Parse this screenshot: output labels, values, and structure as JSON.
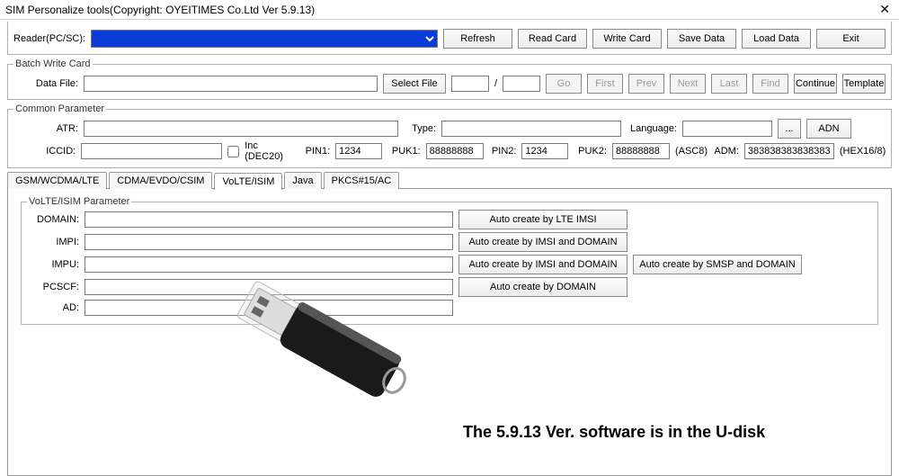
{
  "window": {
    "title": "SIM Personalize tools(Copyright: OYEITIMES Co.Ltd  Ver 5.9.13)"
  },
  "toolbar": {
    "reader_label": "Reader(PC/SC):",
    "refresh": "Refresh",
    "read_card": "Read Card",
    "write_card": "Write Card",
    "save_data": "Save Data",
    "load_data": "Load Data",
    "exit": "Exit"
  },
  "batch": {
    "legend": "Batch Write Card",
    "data_file_label": "Data File:",
    "data_file_value": "",
    "select_file": "Select File",
    "counter_a": "",
    "counter_sep": "/",
    "counter_b": "",
    "go": "Go",
    "first": "First",
    "prev": "Prev",
    "next": "Next",
    "last": "Last",
    "find": "Find",
    "continue": "Continue",
    "template": "Template"
  },
  "common": {
    "legend": "Common Parameter",
    "atr_label": "ATR:",
    "atr_value": "",
    "type_label": "Type:",
    "type_value": "",
    "lang_label": "Language:",
    "lang_value": "",
    "more": "...",
    "adn": "ADN",
    "iccid_label": "ICCID:",
    "iccid_value": "",
    "inc_label": "Inc  (DEC20)",
    "pin1_label": "PIN1:",
    "pin1_value": "1234",
    "puk1_label": "PUK1:",
    "puk1_value": "88888888",
    "pin2_label": "PIN2:",
    "pin2_value": "1234",
    "puk2_label": "PUK2:",
    "puk2_value": "88888888",
    "asc8": "(ASC8)",
    "adm_label": "ADM:",
    "adm_value": "3838383838383838",
    "hex": "(HEX16/8)"
  },
  "tabs": {
    "t0": "GSM/WCDMA/LTE",
    "t1": "CDMA/EVDO/CSIM",
    "t2": "VoLTE/ISIM",
    "t3": "Java",
    "t4": "PKCS#15/AC"
  },
  "volte": {
    "legend": "VoLTE/ISIM  Parameter",
    "domain_label": "DOMAIN:",
    "domain_value": "",
    "impi_label": "IMPI:",
    "impi_value": "",
    "impu_label": "IMPU:",
    "impu_value": "",
    "pcscf_label": "PCSCF:",
    "pcscf_value": "",
    "ad_label": "AD:",
    "ad_value": "",
    "btn_lte": "Auto create by LTE IMSI",
    "btn_imsi_domain": "Auto create by IMSI and DOMAIN",
    "btn_imsi_domain2": "Auto create by IMSI and DOMAIN",
    "btn_smsp": "Auto create by SMSP and DOMAIN",
    "btn_domain": "Auto create by DOMAIN"
  },
  "overlay": "The 5.9.13 Ver. software is in the U-disk"
}
